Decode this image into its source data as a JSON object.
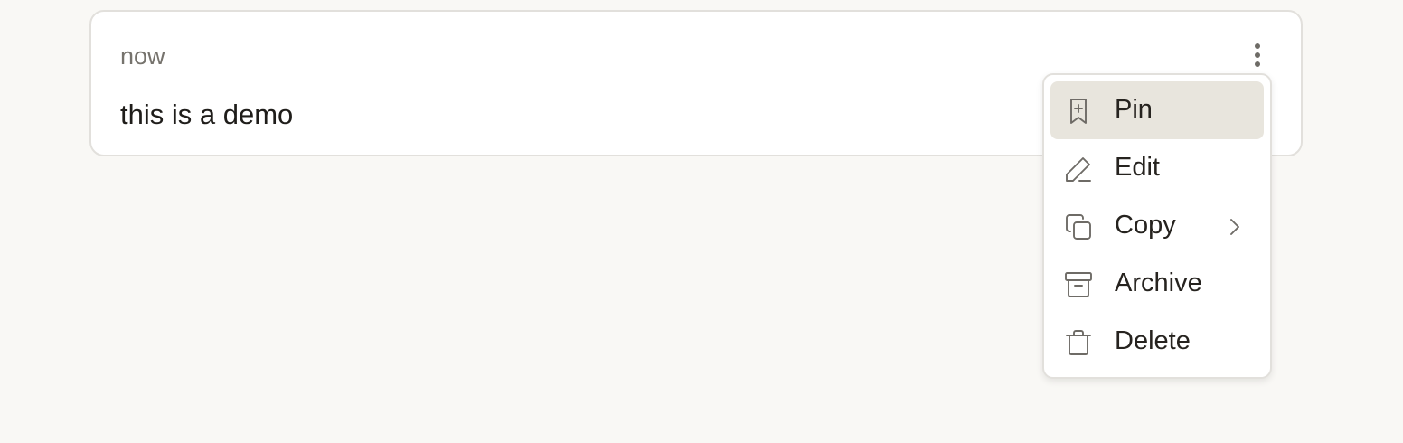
{
  "memo": {
    "time": "now",
    "content": "this is a demo"
  },
  "menu": {
    "items": [
      {
        "label": "Pin",
        "icon": "bookmark-plus-icon",
        "active": true
      },
      {
        "label": "Edit",
        "icon": "pencil-icon"
      },
      {
        "label": "Copy",
        "icon": "copy-icon",
        "has_submenu": true
      },
      {
        "label": "Archive",
        "icon": "archive-icon"
      },
      {
        "label": "Delete",
        "icon": "trash-icon"
      }
    ]
  },
  "colors": {
    "background": "#f9f8f5",
    "card": "#ffffff",
    "border": "#e2e0dc",
    "active_item": "#e8e5dd",
    "text": "#1f1d1a",
    "muted_text": "#76736d",
    "icon": "#6e6b66"
  }
}
